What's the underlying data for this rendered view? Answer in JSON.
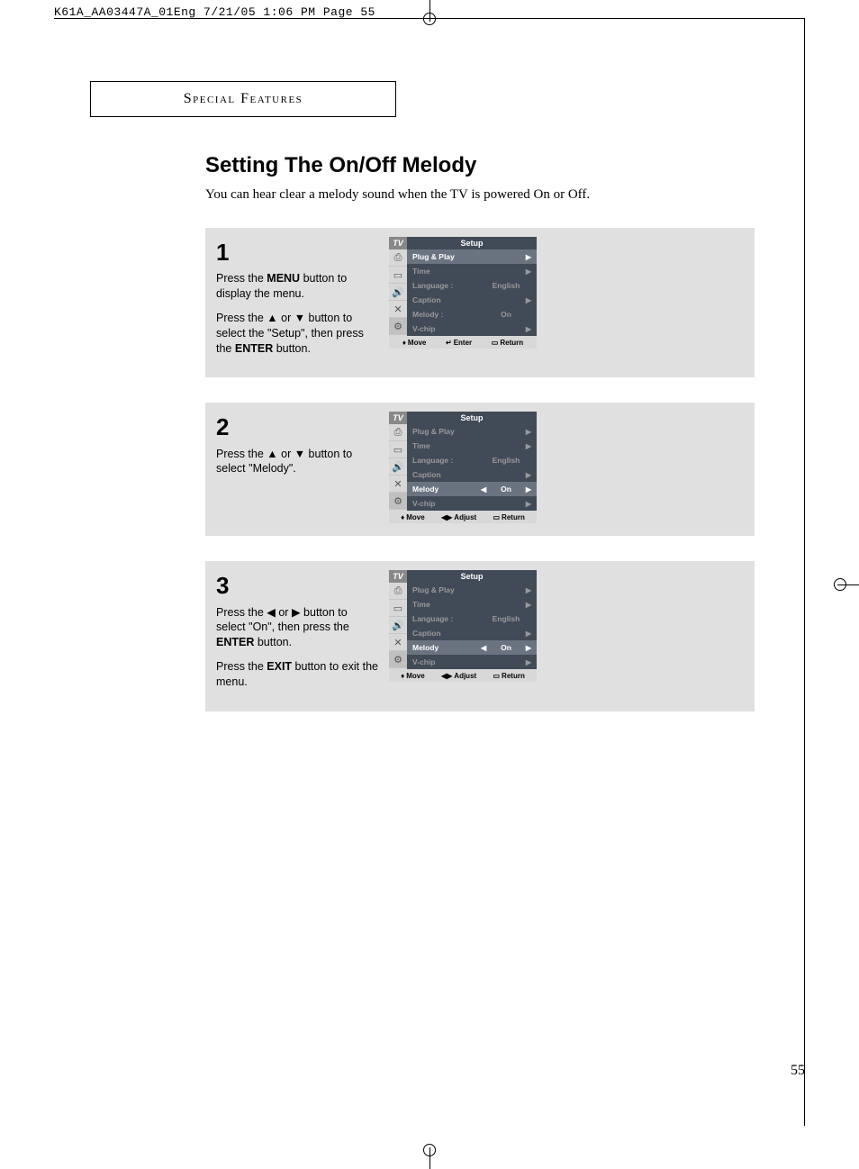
{
  "meta_header": "K61A_AA03447A_01Eng  7/21/05  1:06 PM  Page 55",
  "section_label": "Special Features",
  "title": "Setting The On/Off Melody",
  "intro": "You can hear clear a melody sound when the TV is powered On or Off.",
  "page_number": "55",
  "steps": [
    {
      "num": "1",
      "paras": [
        "Press the <b>MENU</b> button to display the menu.",
        "Press the ▲ or ▼ button to select the \"Setup\", then press the <b>ENTER</b> button."
      ],
      "osd": {
        "tv": "TV",
        "title": "Setup",
        "rows": [
          {
            "label": "Plug & Play",
            "val": "",
            "hl": true,
            "larrow": "",
            "rarrow": "▶"
          },
          {
            "label": "Time",
            "val": "",
            "hl": false,
            "larrow": "",
            "rarrow": "▶"
          },
          {
            "label": "Language :",
            "val": "English",
            "hl": false,
            "larrow": "",
            "rarrow": ""
          },
          {
            "label": "Caption",
            "val": "",
            "hl": false,
            "larrow": "",
            "rarrow": "▶"
          },
          {
            "label": "Melody    :",
            "val": "On",
            "hl": false,
            "larrow": "",
            "rarrow": ""
          },
          {
            "label": "V-chip",
            "val": "",
            "hl": false,
            "larrow": "",
            "rarrow": "▶"
          }
        ],
        "footer": {
          "move": "Move",
          "mid_icon": "↵",
          "mid": "Enter",
          "ret": "Return"
        }
      }
    },
    {
      "num": "2",
      "paras": [
        "Press the ▲ or ▼ button to select \"Melody\"."
      ],
      "osd": {
        "tv": "TV",
        "title": "Setup",
        "rows": [
          {
            "label": "Plug & Play",
            "val": "",
            "hl": false,
            "larrow": "",
            "rarrow": "▶"
          },
          {
            "label": "Time",
            "val": "",
            "hl": false,
            "larrow": "",
            "rarrow": "▶"
          },
          {
            "label": "Language :",
            "val": "English",
            "hl": false,
            "larrow": "",
            "rarrow": ""
          },
          {
            "label": "Caption",
            "val": "",
            "hl": false,
            "larrow": "",
            "rarrow": "▶"
          },
          {
            "label": "Melody",
            "val": "On",
            "hl": true,
            "larrow": "◀",
            "rarrow": "▶"
          },
          {
            "label": "V-chip",
            "val": "",
            "hl": false,
            "larrow": "",
            "rarrow": "▶"
          }
        ],
        "footer": {
          "move": "Move",
          "mid_icon": "◀▶",
          "mid": "Adjust",
          "ret": "Return"
        }
      }
    },
    {
      "num": "3",
      "paras": [
        "Press the ◀ or ▶ button to select \"On\", then press the <b>ENTER</b> button.",
        "Press the <b>EXIT</b> button to exit the menu."
      ],
      "osd": {
        "tv": "TV",
        "title": "Setup",
        "rows": [
          {
            "label": "Plug & Play",
            "val": "",
            "hl": false,
            "larrow": "",
            "rarrow": "▶"
          },
          {
            "label": "Time",
            "val": "",
            "hl": false,
            "larrow": "",
            "rarrow": "▶"
          },
          {
            "label": "Language :",
            "val": "English",
            "hl": false,
            "larrow": "",
            "rarrow": ""
          },
          {
            "label": "Caption",
            "val": "",
            "hl": false,
            "larrow": "",
            "rarrow": "▶"
          },
          {
            "label": "Melody",
            "val": "On",
            "hl": true,
            "larrow": "◀",
            "rarrow": "▶"
          },
          {
            "label": "V-chip",
            "val": "",
            "hl": false,
            "larrow": "",
            "rarrow": "▶"
          }
        ],
        "footer": {
          "move": "Move",
          "mid_icon": "◀▶",
          "mid": "Adjust",
          "ret": "Return"
        }
      }
    }
  ],
  "osd_icons": [
    "⎙",
    "▭",
    "🔊",
    "✕",
    "⚙"
  ]
}
